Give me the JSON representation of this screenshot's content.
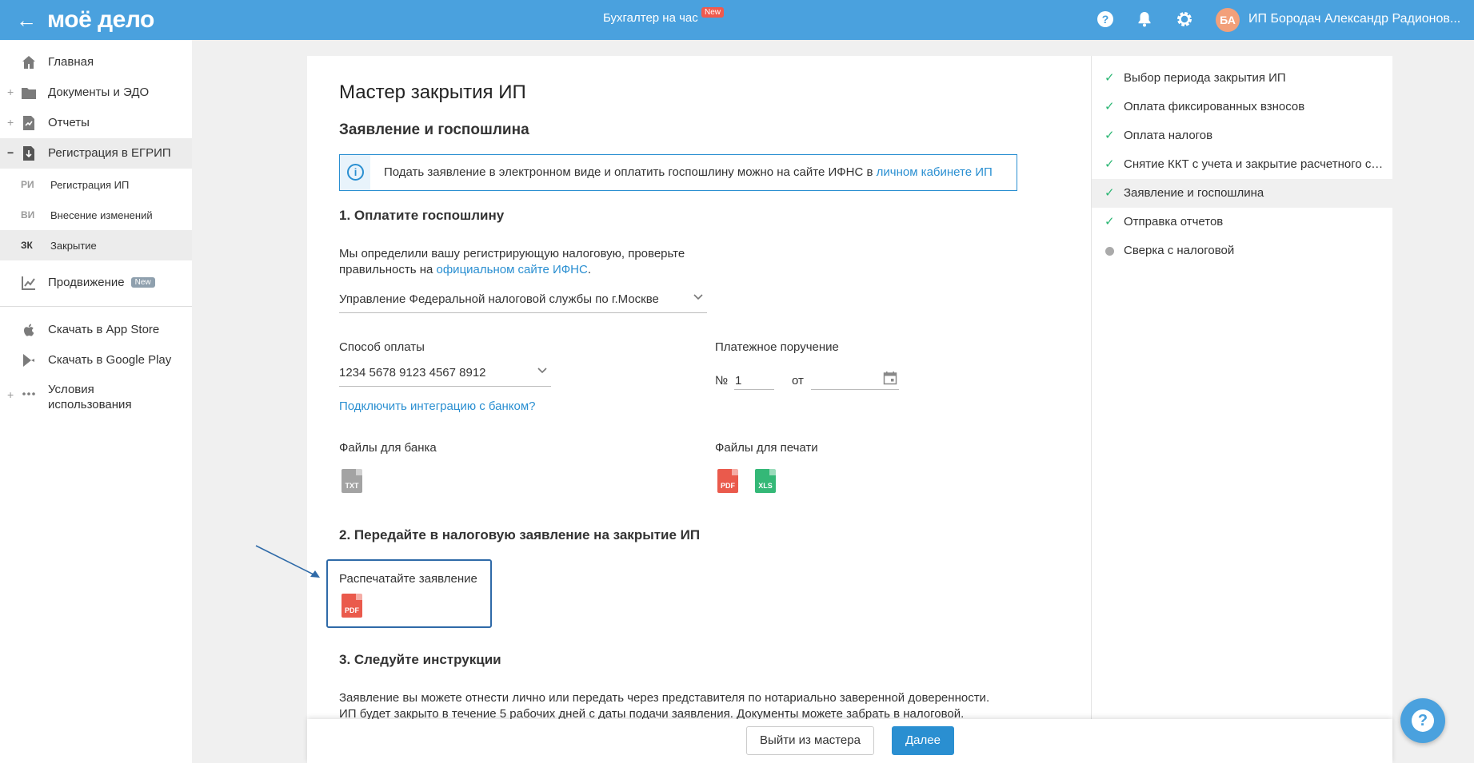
{
  "topbar": {
    "back_icon": "arrow-left-icon",
    "logo": "моё дело",
    "center_label": "Бухгалтер на час",
    "center_badge": "New",
    "help_icon": "?",
    "bell_icon": "🔔",
    "gear_icon": "⚙",
    "avatar_initials": "БА",
    "user_name": "ИП Бородач Александр Радионов..."
  },
  "sidebar": {
    "items": [
      {
        "label": "Главная",
        "icon": "home-icon",
        "plus": ""
      },
      {
        "label": "Документы и ЭДО",
        "icon": "folder-icon",
        "plus": "+"
      },
      {
        "label": "Отчеты",
        "icon": "report-icon",
        "plus": "+"
      },
      {
        "label": "Регистрация в ЕГРИП",
        "icon": "registration-icon",
        "plus": "−"
      }
    ],
    "subitems": [
      {
        "abbr": "РИ",
        "label": "Регистрация ИП"
      },
      {
        "abbr": "ВИ",
        "label": "Внесение изменений"
      },
      {
        "abbr": "ЗК",
        "label": "Закрытие"
      }
    ],
    "promo": {
      "label": "Продвижение",
      "badge": "New"
    },
    "extra": [
      {
        "label": "Скачать в App Store"
      },
      {
        "label": "Скачать в Google Play"
      },
      {
        "label_line1": "Условия",
        "label_line2": "использования",
        "plus": "+"
      }
    ]
  },
  "main": {
    "title": "Мастер закрытия ИП",
    "section_title": "Заявление и госпошлина",
    "info": {
      "text": "Подать заявление в электронном виде и оплатить госпошлину можно на сайте ИФНС в ",
      "link": "личном кабинете ИП"
    },
    "step1": {
      "title": "1. Оплатите госпошлину",
      "desc_line1": "Мы определили вашу регистрирующую налоговую, проверьте",
      "desc_line2": "правильность на ",
      "desc_link": "официальном сайте ИФНС",
      "desc_end": ".",
      "tax_office": "Управление Федеральной налоговой службы по г.Москве",
      "payment_label": "Способ оплаты",
      "payment_value": "1234 5678 9123 4567 8912",
      "bank_link": "Подключить интеграцию с банком?",
      "order_label": "Платежное поручение",
      "order_no_label": "№",
      "order_no": "1",
      "order_from_label": "от",
      "bank_files_label": "Файлы для банка",
      "print_files_label": "Файлы для печати",
      "file_txt": "TXT",
      "file_pdf": "PDF",
      "file_xls": "XLS"
    },
    "step2": {
      "title": "2. Передайте в налоговую заявление на закрытие ИП",
      "print_label": "Распечатайте заявление",
      "file_pdf": "PDF"
    },
    "step3": {
      "title": "3. Следуйте инструкции",
      "line1": "Заявление вы можете отнести лично или передать через представителя по нотариально заверенной доверенности.",
      "line2": "ИП будет закрыто в течение 5 рабочих дней с даты подачи заявления. Документы можете забрать в налоговой."
    }
  },
  "footer": {
    "exit_label": "Выйти из мастера",
    "next_label": "Далее"
  },
  "steps": [
    {
      "label": "Выбор периода закрытия ИП",
      "status": "done"
    },
    {
      "label": "Оплата фиксированных взносов",
      "status": "done"
    },
    {
      "label": "Оплата налогов",
      "status": "done"
    },
    {
      "label": "Снятие ККТ с учета и закрытие расчетного счета",
      "status": "done"
    },
    {
      "label": "Заявление и госпошлина",
      "status": "current"
    },
    {
      "label": "Отправка отчетов",
      "status": "done"
    },
    {
      "label": "Сверка с налоговой",
      "status": "pending"
    }
  ],
  "colors": {
    "topbar": "#4aa1de",
    "accent": "#2a8fd1",
    "check": "#2ab673",
    "pdf": "#ea5a4c",
    "xls": "#34b877",
    "highlight_border": "#2f6aa8"
  }
}
